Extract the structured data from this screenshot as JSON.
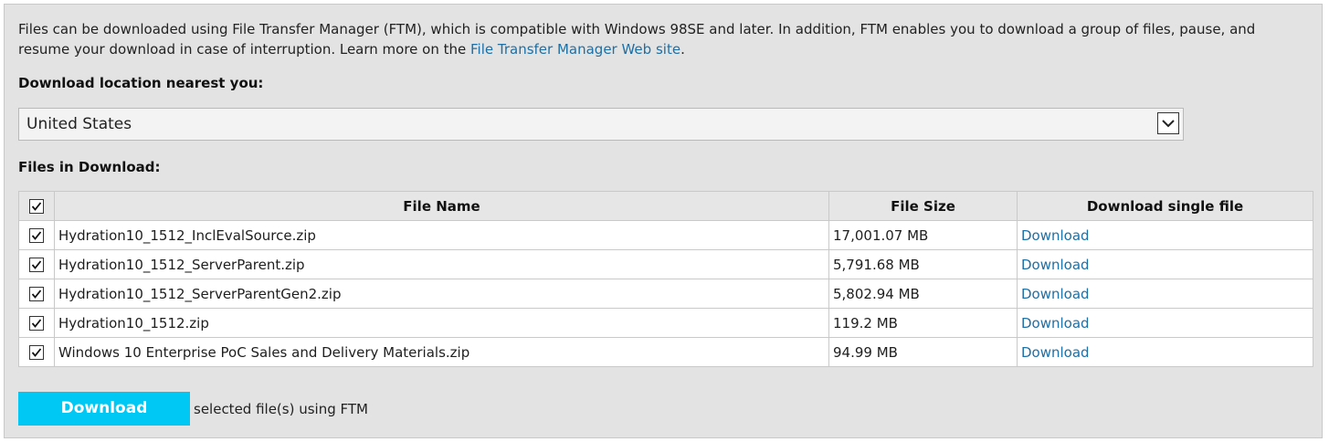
{
  "intro": {
    "text_before": "Files can be downloaded using File Transfer Manager (FTM), which is compatible with Windows 98SE and later. In addition, FTM enables you to download a group of files, pause, and resume your download in case of interruption. Learn more on the ",
    "link": "File Transfer Manager Web site",
    "text_after": "."
  },
  "location": {
    "label": "Download location nearest you:",
    "selected": "United States"
  },
  "files": {
    "label": "Files in Download:",
    "headers": {
      "name": "File Name",
      "size": "File Size",
      "download": "Download single file"
    },
    "rows": [
      {
        "name": "Hydration10_1512_InclEvalSource.zip",
        "size": "17,001.07 MB",
        "link": "Download",
        "checked": true
      },
      {
        "name": "Hydration10_1512_ServerParent.zip",
        "size": "5,791.68 MB",
        "link": "Download",
        "checked": true
      },
      {
        "name": "Hydration10_1512_ServerParentGen2.zip",
        "size": "5,802.94 MB",
        "link": "Download",
        "checked": true
      },
      {
        "name": "Hydration10_1512.zip",
        "size": "119.2 MB",
        "link": "Download",
        "checked": true
      },
      {
        "name": "Windows 10 Enterprise PoC Sales and Delivery Materials.zip",
        "size": "94.99 MB",
        "link": "Download",
        "checked": true
      }
    ]
  },
  "action": {
    "button": "Download",
    "suffix": "selected file(s) using FTM"
  },
  "colors": {
    "accent": "#00c8f5",
    "link": "#1d6fa5",
    "panel": "#e3e3e3"
  }
}
